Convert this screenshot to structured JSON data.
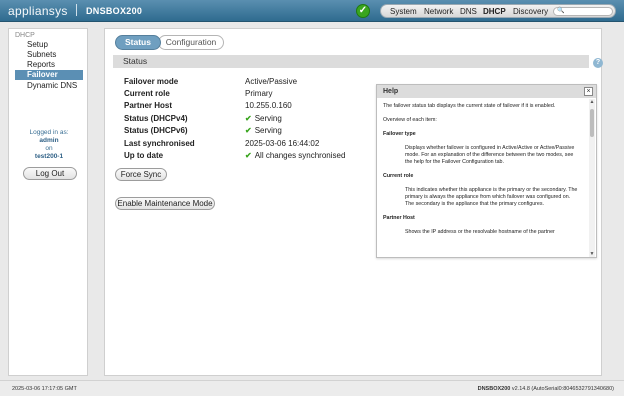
{
  "topbar": {
    "brand": "appliansys",
    "product": "DNSBOX200",
    "nav": [
      "System",
      "Network",
      "DNS",
      "DHCP",
      "Discovery"
    ],
    "active_nav": "DHCP",
    "search_placeholder": "🔍"
  },
  "sidebar": {
    "section": "DHCP",
    "items": [
      "Setup",
      "Subnets",
      "Reports",
      "Failover",
      "Dynamic DNS"
    ],
    "active": "Failover",
    "logged_in_as": "Logged in as:",
    "user": "admin",
    "on": "on",
    "host": "test200-1",
    "logout": "Log Out"
  },
  "tabs": {
    "status": "Status",
    "configuration": "Configuration"
  },
  "section_title": "Status",
  "help_icon": "?",
  "fields": [
    {
      "label": "Failover mode",
      "value": "Active/Passive"
    },
    {
      "label": "Current role",
      "value": "Primary"
    },
    {
      "label": "Partner Host",
      "value": "10.255.0.160"
    },
    {
      "label": "Status (DHCPv4)",
      "value": "Serving"
    },
    {
      "label": "Status (DHCPv6)",
      "value": "Serving"
    },
    {
      "label": "Last synchronised",
      "value": "2025-03-06 16:44:02"
    },
    {
      "label": "Up to date",
      "value": "All changes synchronised"
    }
  ],
  "buttons": {
    "force_sync": "Force Sync",
    "maintenance": "Enable Maintenance Mode"
  },
  "help": {
    "title": "Help",
    "close": "×",
    "intro": "The failover status tab displays the current state of failover if it is enabled.",
    "overview": "Overview of each item:",
    "items": [
      {
        "heading": "Failover type",
        "text": "Displays whether failover is configured in Active/Active or Active/Passive mode. For an explanation of the difference between the two modes, see the help for the Failover Configuration tab."
      },
      {
        "heading": "Current role",
        "text": "This indicates whether this appliance is the primary or the secondary. The primary is always the appliance from which failover was configured on. The secondary is the appliance that the primary configures."
      },
      {
        "heading": "Partner Host",
        "text": "Shows the IP address or the resolvable hostname of the partner"
      }
    ]
  },
  "footer": {
    "timestamp": "2025-03-06 17:17:05 GMT",
    "product": "DNSBOX200",
    "version": " v2.14.8 (AutoSerial0:8046532791340680)"
  },
  "colors": {
    "topbar": "#2f6b8f",
    "accent": "#5b8fb4",
    "ok": "#3aa51f"
  }
}
